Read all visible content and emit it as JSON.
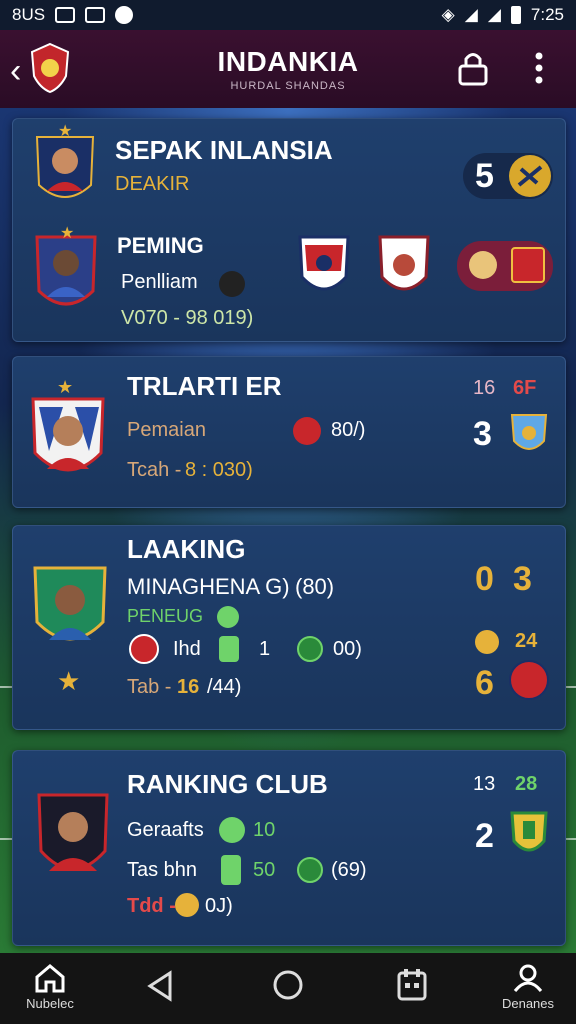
{
  "status": {
    "left_text": "8US",
    "time": "7:25"
  },
  "header": {
    "title": "INDANKIA",
    "subtitle": "HURDAL SHANDAS"
  },
  "cards": [
    {
      "title": "SEPAK INLANSIA",
      "subtitle": "DEAKIR",
      "score": "5",
      "row2_title": "PEMING",
      "row2_line": "Penlliam",
      "row2_stat": "V070 - 98 019)"
    },
    {
      "title": "TRLARTI ER",
      "line1": "Pemaian",
      "line1_value": "80/)",
      "line2": "Tcah -",
      "line2_value": "8 : 030)",
      "stat_a": "16",
      "stat_b": "6F",
      "score": "3"
    },
    {
      "title": "LAAKING",
      "line1": "MINAGHENA G)",
      "line1_value": "(80)",
      "line2": "PENEUG",
      "line3": "Ihd",
      "line3_value": "1",
      "line3_extra": "00)",
      "line4": "Tab -",
      "line4_value": "16",
      "line4_extra": "/44)",
      "score_a": "0",
      "score_b": "3",
      "stat": "24",
      "score_c": "6"
    },
    {
      "title": "RANKING CLUB",
      "line1": "Geraafts",
      "line1_value": "10",
      "line2": "Tas bhn",
      "line2_value": "50",
      "line2_extra": "(69)",
      "line3": "Tdd -",
      "line3_value": "0",
      "line3_extra": "0J)",
      "stat_a": "13",
      "stat_b": "28",
      "score": "2"
    }
  ],
  "nav": {
    "home_label": "Nubelec",
    "profile_label": "Denanes"
  },
  "colors": {
    "accent_gold": "#e6b23a",
    "accent_green": "#6fd36a",
    "header_bg": "#3a1030",
    "card_bg": "#1f3f6d"
  }
}
